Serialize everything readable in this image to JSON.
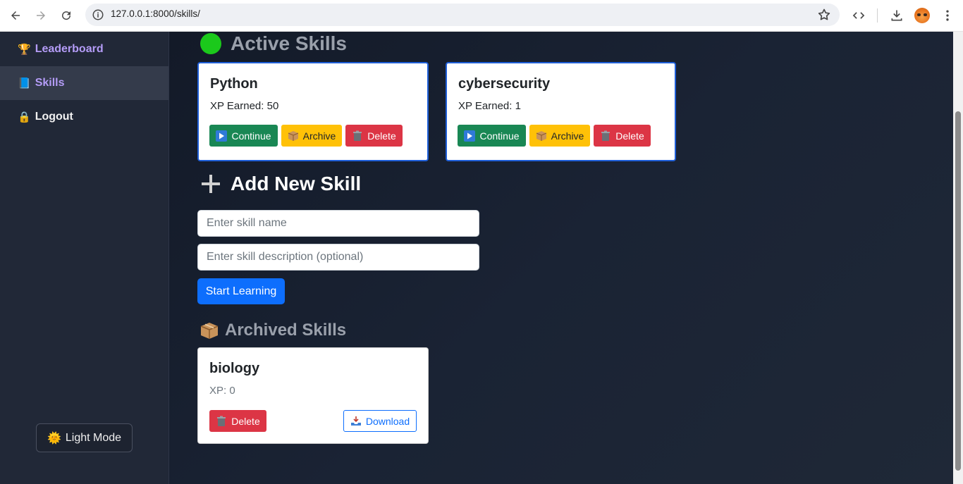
{
  "browser": {
    "url": "127.0.0.1:8000/skills/"
  },
  "sidebar": {
    "items": [
      {
        "label": "Leaderboard",
        "icon": "trophy-icon",
        "emoji": "🏆"
      },
      {
        "label": "Skills",
        "icon": "book-icon",
        "emoji": "📘"
      },
      {
        "label": "Logout",
        "icon": "lock-icon",
        "emoji": "🔒"
      }
    ],
    "mode_button": {
      "label": "Light Mode",
      "emoji": "🌞"
    }
  },
  "active_section": {
    "title": "Active Skills",
    "skills": [
      {
        "name": "Python",
        "xp_text": "XP Earned: 50",
        "continue_label": "Continue",
        "archive_label": "Archive",
        "delete_label": "Delete"
      },
      {
        "name": "cybersecurity",
        "xp_text": "XP Earned: 1",
        "continue_label": "Continue",
        "archive_label": "Archive",
        "delete_label": "Delete"
      }
    ]
  },
  "add_section": {
    "title": "Add New Skill",
    "name_placeholder": "Enter skill name",
    "description_placeholder": "Enter skill description (optional)",
    "submit_label": "Start Learning"
  },
  "archived_section": {
    "title": "Archived Skills",
    "skills": [
      {
        "name": "biology",
        "xp_text": "XP: 0",
        "delete_label": "Delete",
        "download_label": "Download"
      }
    ]
  },
  "colors": {
    "accent": "#0d6efd",
    "success": "#198754",
    "warning": "#ffc107",
    "danger": "#dc3545",
    "sidebar_link": "#b49cf7"
  }
}
